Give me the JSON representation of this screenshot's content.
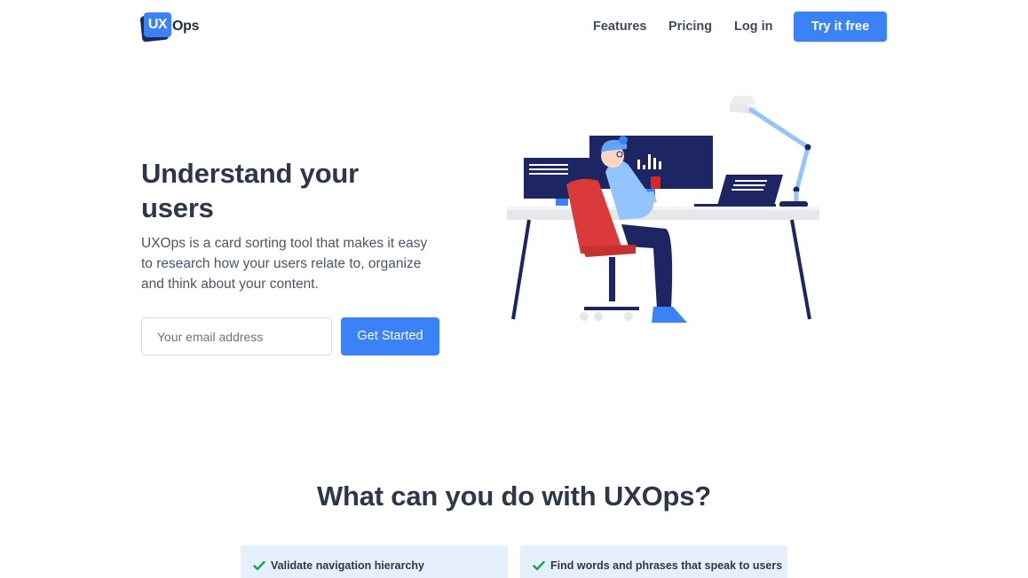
{
  "brand": {
    "badge_text": "UX",
    "name_text": "Ops",
    "accent": "#3b82f6",
    "dark": "#1a2a5e"
  },
  "nav": {
    "features": "Features",
    "pricing": "Pricing",
    "login": "Log in",
    "cta": "Try it free"
  },
  "hero": {
    "title": "Understand your users",
    "description": "UXOps is a card sorting tool that makes it easy to research how your users relate to, organize and think about your content.",
    "email_placeholder": "Your email address",
    "email_value": "",
    "submit_label": "Get Started"
  },
  "features": {
    "title": "What can you do with UXOps?",
    "items": [
      {
        "label": "Validate navigation hierarchy",
        "icon": "check-icon"
      },
      {
        "label": "Find words and phrases that speak to users",
        "icon": "check-icon"
      }
    ],
    "check_color": "#16a34a"
  }
}
